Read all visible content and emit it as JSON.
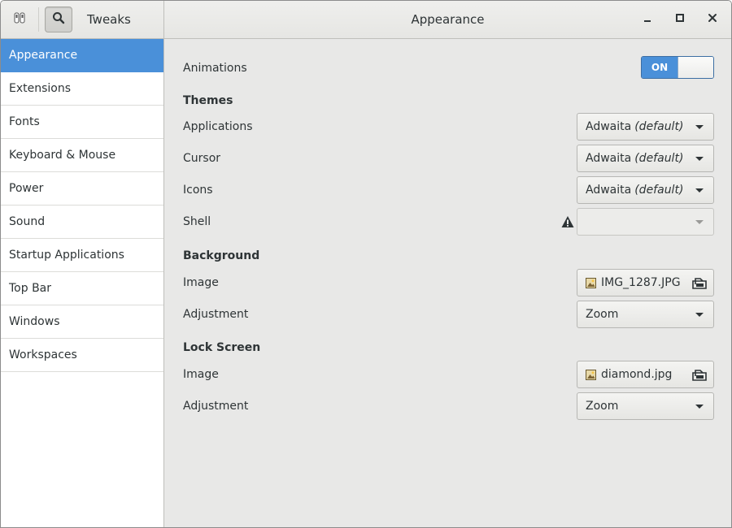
{
  "header": {
    "app_title": "Tweaks",
    "page_title": "Appearance"
  },
  "sidebar": {
    "items": [
      {
        "label": "Appearance",
        "selected": true
      },
      {
        "label": "Extensions"
      },
      {
        "label": "Fonts"
      },
      {
        "label": "Keyboard & Mouse"
      },
      {
        "label": "Power"
      },
      {
        "label": "Sound"
      },
      {
        "label": "Startup Applications"
      },
      {
        "label": "Top Bar"
      },
      {
        "label": "Windows"
      },
      {
        "label": "Workspaces"
      }
    ]
  },
  "main": {
    "animations": {
      "label": "Animations",
      "switch_label": "ON",
      "enabled": true
    },
    "themes": {
      "heading": "Themes",
      "applications": {
        "label": "Applications",
        "value": "Adwaita",
        "value_note": "(default)"
      },
      "cursor": {
        "label": "Cursor",
        "value": "Adwaita",
        "value_note": "(default)"
      },
      "icons": {
        "label": "Icons",
        "value": "Adwaita",
        "value_note": "(default)"
      },
      "shell": {
        "label": "Shell",
        "value": "",
        "warning": true
      }
    },
    "background": {
      "heading": "Background",
      "image": {
        "label": "Image",
        "value": "IMG_1287.JPG"
      },
      "adjustment": {
        "label": "Adjustment",
        "value": "Zoom"
      }
    },
    "lock_screen": {
      "heading": "Lock Screen",
      "image": {
        "label": "Image",
        "value": "diamond.jpg"
      },
      "adjustment": {
        "label": "Adjustment",
        "value": "Zoom"
      }
    }
  },
  "colors": {
    "accent": "#4a90d9",
    "sidebar_bg": "#ffffff",
    "content_bg": "#e8e8e7"
  },
  "icons": [
    "tweaks-app-icon",
    "search-icon",
    "minimize-icon",
    "maximize-icon",
    "close-icon",
    "warning-icon",
    "image-file-icon",
    "document-open-icon",
    "dropdown-arrow-icon"
  ]
}
